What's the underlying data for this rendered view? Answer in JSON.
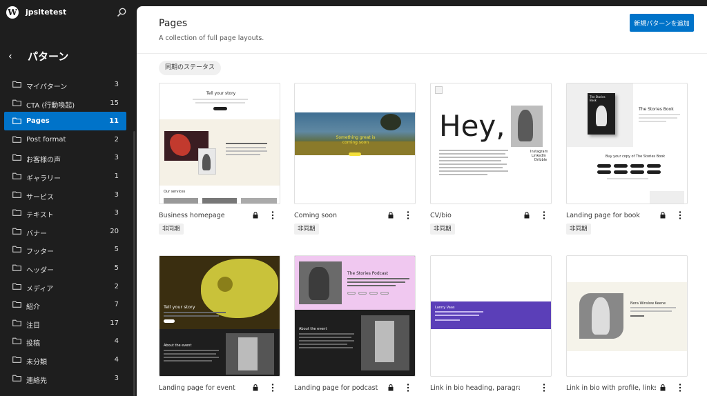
{
  "site": {
    "title": "jpsitetest"
  },
  "sidebar": {
    "section_title": "パターン",
    "categories": [
      {
        "label": "マイパターン",
        "count": "3"
      },
      {
        "label": "CTA (行動喚起)",
        "count": "15"
      },
      {
        "label": "Pages",
        "count": "11",
        "active": true
      },
      {
        "label": "Post format",
        "count": "2"
      },
      {
        "label": "お客様の声",
        "count": "3"
      },
      {
        "label": "ギャラリー",
        "count": "1"
      },
      {
        "label": "サービス",
        "count": "3"
      },
      {
        "label": "テキスト",
        "count": "3"
      },
      {
        "label": "バナー",
        "count": "20"
      },
      {
        "label": "フッター",
        "count": "5"
      },
      {
        "label": "ヘッダー",
        "count": "5"
      },
      {
        "label": "メディア",
        "count": "2"
      },
      {
        "label": "紹介",
        "count": "7"
      },
      {
        "label": "注目",
        "count": "17"
      },
      {
        "label": "投稿",
        "count": "4"
      },
      {
        "label": "未分類",
        "count": "4"
      },
      {
        "label": "連絡先",
        "count": "3"
      }
    ]
  },
  "main": {
    "title": "Pages",
    "subtitle": "A collection of full page layouts.",
    "add_button": "新規パターンを追加",
    "filter_chip": "同期のステータス",
    "patterns": [
      {
        "title": "Business homepage",
        "badge": "非同期"
      },
      {
        "title": "Coming soon",
        "badge": "非同期"
      },
      {
        "title": "CV/bio",
        "badge": "非同期"
      },
      {
        "title": "Landing page for book",
        "badge": "非同期"
      },
      {
        "title": "Landing page for event"
      },
      {
        "title": "Landing page for podcast"
      },
      {
        "title": "Link in bio heading, paragraph,"
      },
      {
        "title": "Link in bio with profile, links and"
      }
    ]
  },
  "thumbs": {
    "business": {
      "heading": "Tell your story",
      "services": "Our services"
    },
    "coming_soon": {
      "heading": "Something great is coming soon"
    },
    "cv": {
      "heading": "Hey,",
      "links": [
        "Instagram",
        "LinkedIn",
        "Dribble"
      ]
    },
    "book": {
      "heading": "The Stories Book",
      "cta": "Buy your copy of The Stories Book",
      "cover": "The Stories Book"
    },
    "event": {
      "heading": "Tell your story",
      "about": "About the event"
    },
    "podcast": {
      "heading": "The Stories Podcast",
      "about": "About the event"
    },
    "link_bio": {
      "name": "Lanny Vaas"
    },
    "link_bio2": {
      "name": "Nora Winslow Keene"
    }
  },
  "colors": {
    "accent": "#0073c9",
    "sidebar_bg": "#1e1e1e",
    "podcast_pink": "#f0c8f0",
    "link_purple": "#5b3fb8",
    "coming_soon_yellow": "#f5e03a"
  }
}
